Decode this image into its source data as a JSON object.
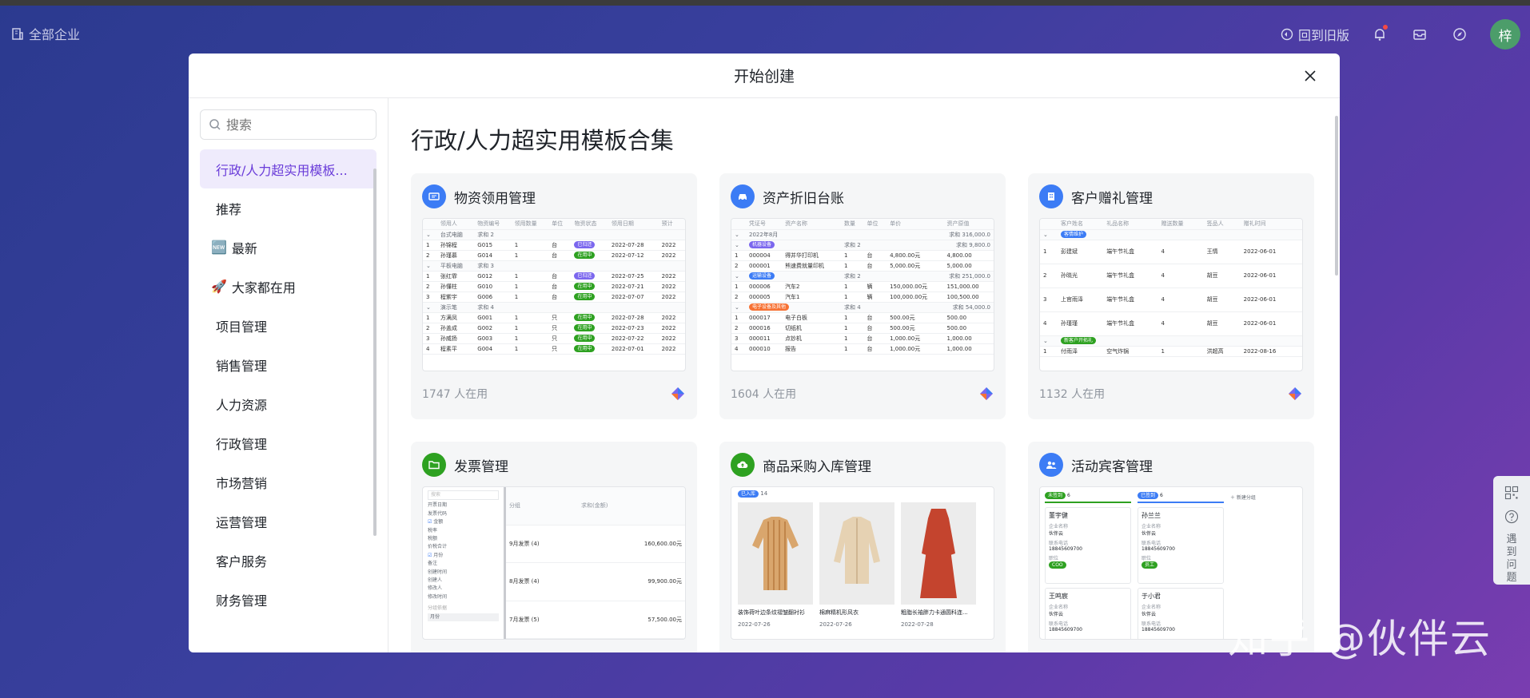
{
  "topbar": {
    "org_label": "全部企业",
    "back_old_label": "回到旧版",
    "avatar_text": "梓"
  },
  "modal": {
    "title": "开始创建",
    "search_placeholder": "搜索",
    "section_title": "行政/人力超实用模板合集"
  },
  "sidebar": {
    "items": [
      {
        "label": "行政/人力超实用模板...",
        "icon": ""
      },
      {
        "label": "推荐",
        "icon": ""
      },
      {
        "label": "最新",
        "icon": "🆕"
      },
      {
        "label": "大家都在用",
        "icon": "🚀"
      },
      {
        "label": "项目管理",
        "icon": ""
      },
      {
        "label": "销售管理",
        "icon": ""
      },
      {
        "label": "人力资源",
        "icon": ""
      },
      {
        "label": "行政管理",
        "icon": ""
      },
      {
        "label": "市场营销",
        "icon": ""
      },
      {
        "label": "运营管理",
        "icon": ""
      },
      {
        "label": "客户服务",
        "icon": ""
      },
      {
        "label": "财务管理",
        "icon": ""
      }
    ]
  },
  "cards": [
    {
      "title": "物资领用管理",
      "users": "1747 人在用",
      "icon_color": "#3c7cf5"
    },
    {
      "title": "资产折旧台账",
      "users": "1604 人在用",
      "icon_color": "#3c7cf5"
    },
    {
      "title": "客户赠礼管理",
      "users": "1132 人在用",
      "icon_color": "#3c7cf5"
    },
    {
      "title": "发票管理",
      "users": "",
      "icon_color": "#2ea121"
    },
    {
      "title": "商品采购入库管理",
      "users": "",
      "icon_color": "#2ea121"
    },
    {
      "title": "活动宾客管理",
      "users": "",
      "icon_color": "#3c7cf5"
    }
  ],
  "preview1": {
    "headers": [
      "",
      "领用人",
      "物资编号",
      "领用数量",
      "单位",
      "物资状态",
      "领用日期",
      "预计"
    ],
    "groups": [
      {
        "name": "台式电脑",
        "count": "求和 2",
        "rows": [
          [
            "1",
            "孙锦程",
            "G015",
            "1",
            "台",
            "已归还",
            "2022-07-28",
            "2022"
          ],
          [
            "2",
            "孙瑾慕",
            "G014",
            "1",
            "台",
            "在用中",
            "2022-07-12",
            "2022"
          ]
        ]
      },
      {
        "name": "平板电脑",
        "count": "求和 3",
        "rows": [
          [
            "1",
            "张红霏",
            "G012",
            "1",
            "台",
            "已归还",
            "2022-07-25",
            "2022"
          ],
          [
            "2",
            "孙懂柱",
            "G010",
            "1",
            "台",
            "在用中",
            "2022-07-21",
            "2022"
          ],
          [
            "3",
            "程紫宇",
            "G006",
            "1",
            "台",
            "在用中",
            "2022-07-07",
            "2022"
          ]
        ]
      },
      {
        "name": "演示笔",
        "count": "求和 4",
        "rows": [
          [
            "1",
            "方满凤",
            "G001",
            "1",
            "只",
            "在用中",
            "2022-07-28",
            "2022"
          ],
          [
            "2",
            "孙盖成",
            "G002",
            "1",
            "只",
            "在用中",
            "2022-07-23",
            "2022"
          ],
          [
            "3",
            "孙威扬",
            "G003",
            "1",
            "只",
            "在用中",
            "2022-07-22",
            "2022"
          ],
          [
            "4",
            "程素平",
            "G004",
            "1",
            "只",
            "在用中",
            "2022-07-01",
            "2022"
          ]
        ]
      }
    ]
  },
  "preview2": {
    "headers": [
      "",
      "凭证号",
      "资产名称",
      "数量",
      "单位",
      "单价",
      "资产原值"
    ],
    "top_group": "2022年8月",
    "top_sum": "求和 316,000.0",
    "groups": [
      {
        "tag": "机器设备",
        "tag_color": "#7b67ee",
        "count": "求和 2",
        "sum": "求和 9,800.0",
        "rows": [
          [
            "1",
            "000004",
            "得并华打印机",
            "1",
            "台",
            "4,800.00元",
            "4,800.00"
          ],
          [
            "2",
            "000001",
            "熊速费就量印机",
            "1",
            "台",
            "5,000.00元",
            "5,000.00"
          ]
        ]
      },
      {
        "tag": "运输设备",
        "tag_color": "#3c7cf5",
        "count": "求和 2",
        "sum": "求和 251,000.0",
        "rows": [
          [
            "1",
            "000006",
            "汽车2",
            "1",
            "辆",
            "150,000.00元",
            "151,000.00"
          ],
          [
            "2",
            "000005",
            "汽车1",
            "1",
            "辆",
            "100,000.00元",
            "100,500.00"
          ]
        ]
      },
      {
        "tag": "电子设备及其他",
        "tag_color": "#f77234",
        "count": "求和 4",
        "sum": "求和 54,000.0",
        "rows": [
          [
            "1",
            "000017",
            "电子白板",
            "1",
            "台",
            "500.00元",
            "500.00"
          ],
          [
            "2",
            "000016",
            "切纸机",
            "1",
            "台",
            "500.00元",
            "500.00"
          ],
          [
            "3",
            "000011",
            "点钞机",
            "1",
            "台",
            "1,000.00元",
            "1,000.00"
          ],
          [
            "4",
            "000010",
            "报告",
            "1",
            "台",
            "1,000.00元",
            "1,000.00"
          ]
        ]
      }
    ]
  },
  "preview3": {
    "headers": [
      "",
      "客户姓名",
      "礼品名称",
      "赠送数量",
      "签品人",
      "赠礼时间",
      ""
    ],
    "groups": [
      {
        "tag": "客情维护",
        "rows": [
          [
            "1",
            "彭建斌",
            "端午节礼盒",
            "4",
            "王情",
            "2022-06-01"
          ],
          [
            "2",
            "孙晓光",
            "端午节礼盒",
            "4",
            "胡豆",
            "2022-06-01"
          ],
          [
            "3",
            "上官雨泽",
            "端午节礼盒",
            "4",
            "胡豆",
            "2022-06-01"
          ],
          [
            "4",
            "孙瑾瑾",
            "端午节礼盒",
            "4",
            "胡豆",
            "2022-06-01"
          ]
        ]
      },
      {
        "tag": "新客户开拓礼",
        "rows": [
          [
            "1",
            "付雨泽",
            "空气炸锅",
            "1",
            "洪超高",
            "2022-08-16"
          ]
        ]
      }
    ]
  },
  "preview4": {
    "search_label": "搜索",
    "fields": [
      "开票日期",
      "发票代码",
      "金额",
      "税率",
      "税额",
      "价税合计",
      "月份",
      "备注",
      "创建时间",
      "创建人",
      "修改人",
      "修改时间"
    ],
    "checked": [
      "金额",
      "月份"
    ],
    "groupby_label": "分组依据",
    "groupby_value": "月份",
    "col_group": "分组",
    "col_sum": "求和(金额)",
    "rows": [
      [
        "9月发票 (4)",
        "160,600.00元"
      ],
      [
        "8月发票 (4)",
        "99,900.00元"
      ],
      [
        "7月发票 (5)",
        "57,500.00元"
      ]
    ]
  },
  "preview5": {
    "group_tag": "已入库",
    "group_count": "14",
    "items": [
      {
        "name": "装饰荷叶边条纹褶皱翻衬衫",
        "date": "2022-07-26",
        "color": "#d9a66d"
      },
      {
        "name": "棉麻精机形风衣",
        "date": "2022-07-26",
        "color": "#e6d2b3"
      },
      {
        "name": "粗脂长袖胖力卡通圆科连...",
        "date": "2022-07-28",
        "color": "#c4442e"
      }
    ]
  },
  "preview6": {
    "add_group": "新建分组",
    "columns": [
      {
        "tag": "未签到",
        "tag_color": "#2ea121",
        "count": "6",
        "cards": [
          {
            "name": "董宇健",
            "company_label": "企业名称",
            "company": "伙伴云",
            "phone_label": "联系电话",
            "phone": "18845609700",
            "role_label": "职位",
            "role": "COO"
          },
          {
            "name": "王鸣宸",
            "company_label": "企业名称",
            "company": "伙伴云",
            "phone_label": "联系电话",
            "phone": "18845609700",
            "role_label": "",
            "role": ""
          }
        ]
      },
      {
        "tag": "已签到",
        "tag_color": "#3c7cf5",
        "count": "6",
        "cards": [
          {
            "name": "孙兰兰",
            "company_label": "企业名称",
            "company": "伙伴云",
            "phone_label": "联系电话",
            "phone": "18845609700",
            "role_label": "职位",
            "role": "员工"
          },
          {
            "name": "于小君",
            "company_label": "企业名称",
            "company": "伙伴云",
            "phone_label": "联系电话",
            "phone": "18845609700",
            "role_label": "",
            "role": ""
          }
        ]
      }
    ]
  },
  "float_help": {
    "label": "遇到问题"
  },
  "watermark": "知乎 @伙伴云"
}
